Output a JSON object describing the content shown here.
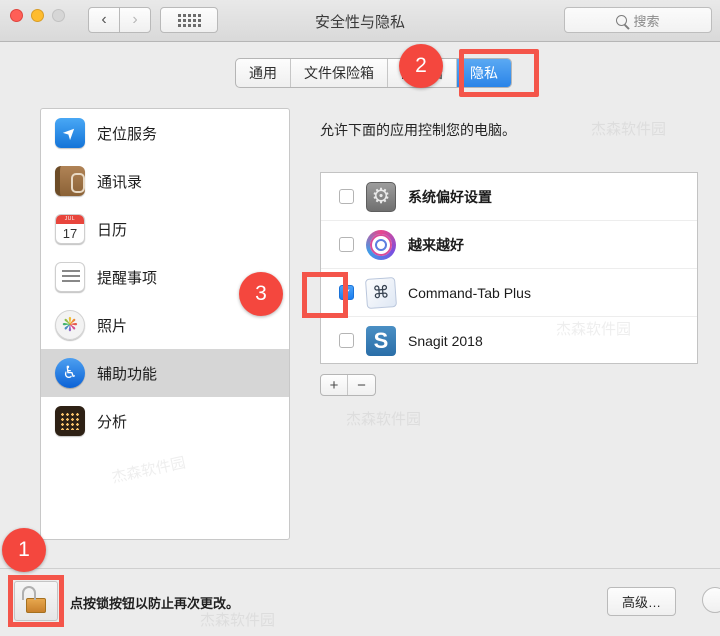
{
  "window": {
    "title": "安全性与隐私",
    "traffic_lights": [
      "close",
      "minimize",
      "zoom"
    ],
    "nav": {
      "back_icon": "chevron-left-icon",
      "forward_icon": "chevron-right-icon",
      "showall_icon": "grid-icon"
    },
    "search": {
      "placeholder": "搜索",
      "icon": "search-icon"
    }
  },
  "tabs": [
    {
      "label": "通用",
      "active": false
    },
    {
      "label": "文件保险箱",
      "active": false
    },
    {
      "label": "防火墙",
      "active": false
    },
    {
      "label": "隐私",
      "active": true
    }
  ],
  "sidebar": {
    "items": [
      {
        "label": "定位服务",
        "icon": "location-services-icon",
        "selected": false
      },
      {
        "label": "通讯录",
        "icon": "contacts-icon",
        "selected": false
      },
      {
        "label": "日历",
        "icon": "calendar-icon",
        "selected": false
      },
      {
        "label": "提醒事项",
        "icon": "reminders-icon",
        "selected": false
      },
      {
        "label": "照片",
        "icon": "photos-icon",
        "selected": false
      },
      {
        "label": "辅助功能",
        "icon": "accessibility-icon",
        "selected": true
      },
      {
        "label": "分析",
        "icon": "analytics-icon",
        "selected": false
      }
    ]
  },
  "pane": {
    "description": "允许下面的应用控制您的电脑。",
    "apps": [
      {
        "name": "系统偏好设置",
        "icon": "system-preferences-icon",
        "checked": false
      },
      {
        "name": "越来越好",
        "icon": "better-and-better-icon",
        "checked": false
      },
      {
        "name": "Command-Tab Plus",
        "icon": "command-tab-plus-icon",
        "checked": true
      },
      {
        "name": "Snagit 2018",
        "icon": "snagit-icon",
        "checked": false
      }
    ],
    "add_label": "+",
    "remove_label": "−"
  },
  "bottom": {
    "lock_icon": "unlocked-padlock-icon",
    "lock_note": "点按锁按钮以防止再次更改。",
    "advanced_label": "高级…",
    "help_label": "?"
  },
  "annotations": {
    "badges": [
      {
        "number": "1",
        "target": "lock-button"
      },
      {
        "number": "2",
        "target": "privacy-tab"
      },
      {
        "number": "3",
        "target": "command-tab-plus-checkbox"
      }
    ],
    "highlight_color": "#f4554a"
  },
  "watermark": "杰森软件园"
}
